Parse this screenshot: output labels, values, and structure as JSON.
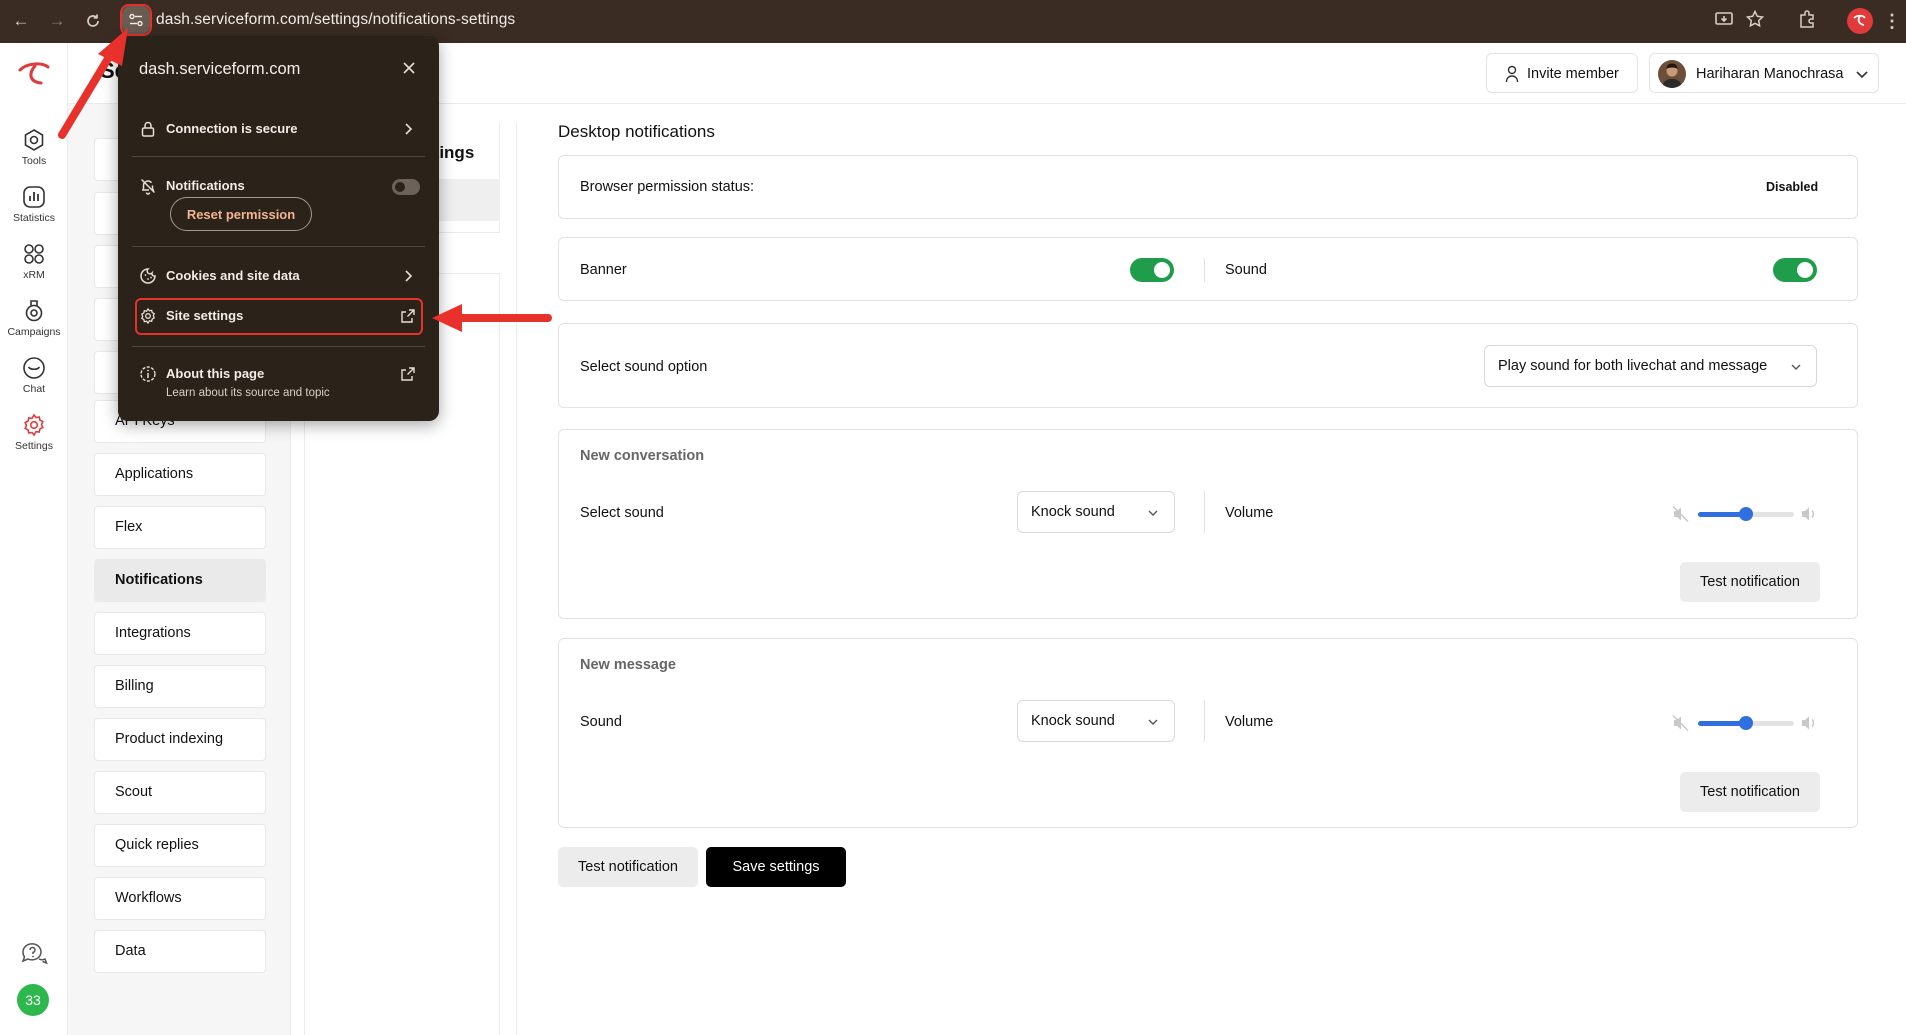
{
  "browser": {
    "url": "dash.serviceform.com/settings/notifications-settings"
  },
  "rail": {
    "items": [
      {
        "label": "Tools",
        "icon": "tools-icon"
      },
      {
        "label": "Statistics",
        "icon": "statistics-icon"
      },
      {
        "label": "xRM",
        "icon": "xrm-icon"
      },
      {
        "label": "Campaigns",
        "icon": "campaigns-icon"
      },
      {
        "label": "Chat",
        "icon": "chat-icon"
      },
      {
        "label": "Settings",
        "icon": "settings-icon"
      }
    ],
    "badge_count": "33",
    "accent_color": "#e03a3a"
  },
  "header": {
    "title_fragment": "Se",
    "invite_label": "Invite member",
    "user_name": "Hariharan Manochrasa"
  },
  "settings_menu": {
    "items": [
      {
        "label": "API Keys"
      },
      {
        "label": "Applications"
      },
      {
        "label": "Flex"
      },
      {
        "label": "Notifications",
        "active": true
      },
      {
        "label": "Integrations"
      },
      {
        "label": "Billing"
      },
      {
        "label": "Product indexing"
      },
      {
        "label": "Scout"
      },
      {
        "label": "Quick replies"
      },
      {
        "label": "Workflows"
      },
      {
        "label": "Data"
      }
    ]
  },
  "sub_panel": {
    "title_fragment": "ttings"
  },
  "main": {
    "heading": "Desktop notifications",
    "permission": {
      "label": "Browser permission status:",
      "value": "Disabled"
    },
    "banner": {
      "label": "Banner",
      "enabled": true
    },
    "sound": {
      "label": "Sound",
      "enabled": true
    },
    "sound_option": {
      "label": "Select sound option",
      "value": "Play sound for both livechat and message"
    },
    "new_conversation": {
      "heading": "New conversation",
      "select_label": "Select sound",
      "sound_value": "Knock sound",
      "volume_label": "Volume",
      "volume_level": 0.5,
      "test_label": "Test notification"
    },
    "new_message": {
      "heading": "New message",
      "select_label": "Sound",
      "sound_value": "Knock sound",
      "volume_label": "Volume",
      "volume_level": 0.5,
      "test_label": "Test notification"
    },
    "footer": {
      "test_label": "Test notification",
      "save_label": "Save settings"
    },
    "toggle_color": "#1f9d4b",
    "slider_color": "#2f6fe0"
  },
  "site_popup": {
    "domain": "dash.serviceform.com",
    "connection_label": "Connection is secure",
    "notifications_label": "Notifications",
    "notifications_enabled": false,
    "reset_label": "Reset permission",
    "cookies_label": "Cookies and site data",
    "site_settings_label": "Site settings",
    "about_label": "About this page",
    "about_sub": "Learn about its source and topic",
    "highlight_color": "#e8312b"
  }
}
